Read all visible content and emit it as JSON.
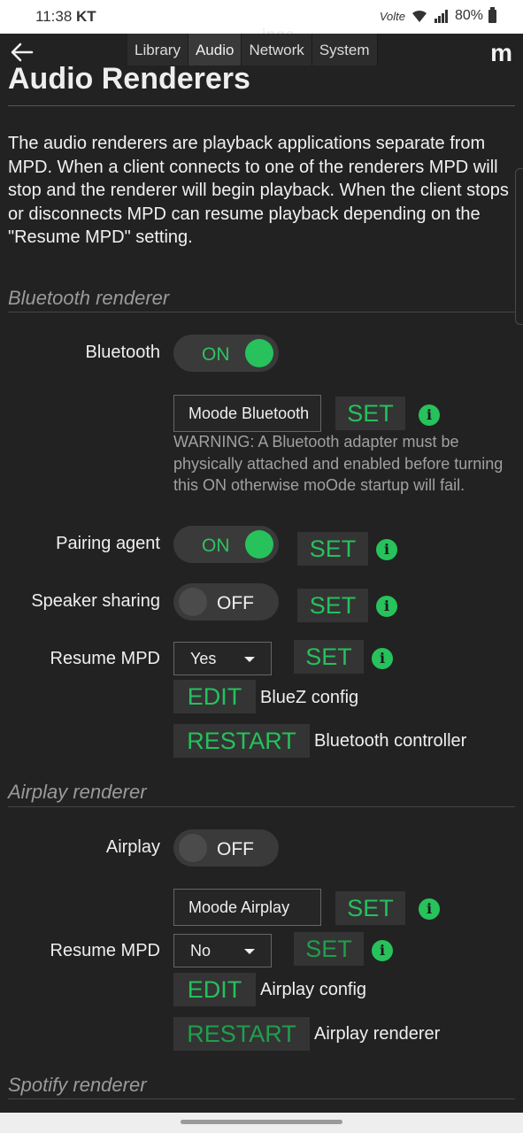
{
  "status_bar": {
    "time": "11:38",
    "carrier": "KT",
    "network": "Volte",
    "battery": "80%"
  },
  "header": {
    "tabs": [
      "Library",
      "Audio",
      "Network",
      "System"
    ],
    "active_tab": "Audio",
    "ghost_title": "ings",
    "logo": "m"
  },
  "page": {
    "title": "Audio Renderers",
    "intro": "The audio renderers are playback applications separate from MPD. When a client connects to one of the renderers MPD will stop and the renderer will begin playback. When the client stops or disconnects MPD can resume playback depending on the \"Resume MPD\" setting."
  },
  "bluetooth": {
    "section_title": "Bluetooth renderer",
    "bluetooth_label": "Bluetooth",
    "bluetooth_state": "ON",
    "name_value": "Moode Bluetooth",
    "set_label": "SET",
    "warning": "WARNING: A Bluetooth adapter must be physically attached and enabled before turning this ON otherwise moOde startup will fail.",
    "pairing_label": "Pairing agent",
    "pairing_state": "ON",
    "speaker_label": "Speaker sharing",
    "speaker_state": "OFF",
    "resume_label": "Resume MPD",
    "resume_value": "Yes",
    "edit_label": "EDIT",
    "edit_text": "BlueZ config",
    "restart_label": "RESTART",
    "restart_text": "Bluetooth controller"
  },
  "airplay": {
    "section_title": "Airplay renderer",
    "airplay_label": "Airplay",
    "airplay_state": "OFF",
    "name_value": "Moode Airplay",
    "set_label": "SET",
    "resume_label": "Resume MPD",
    "resume_value": "No",
    "edit_label": "EDIT",
    "edit_text": "Airplay config",
    "restart_label": "RESTART",
    "restart_text": "Airplay renderer"
  },
  "spotify": {
    "section_title": "Spotify renderer"
  },
  "info_glyph": "i",
  "colors": {
    "accent": "#27c25c",
    "background": "#222222"
  }
}
